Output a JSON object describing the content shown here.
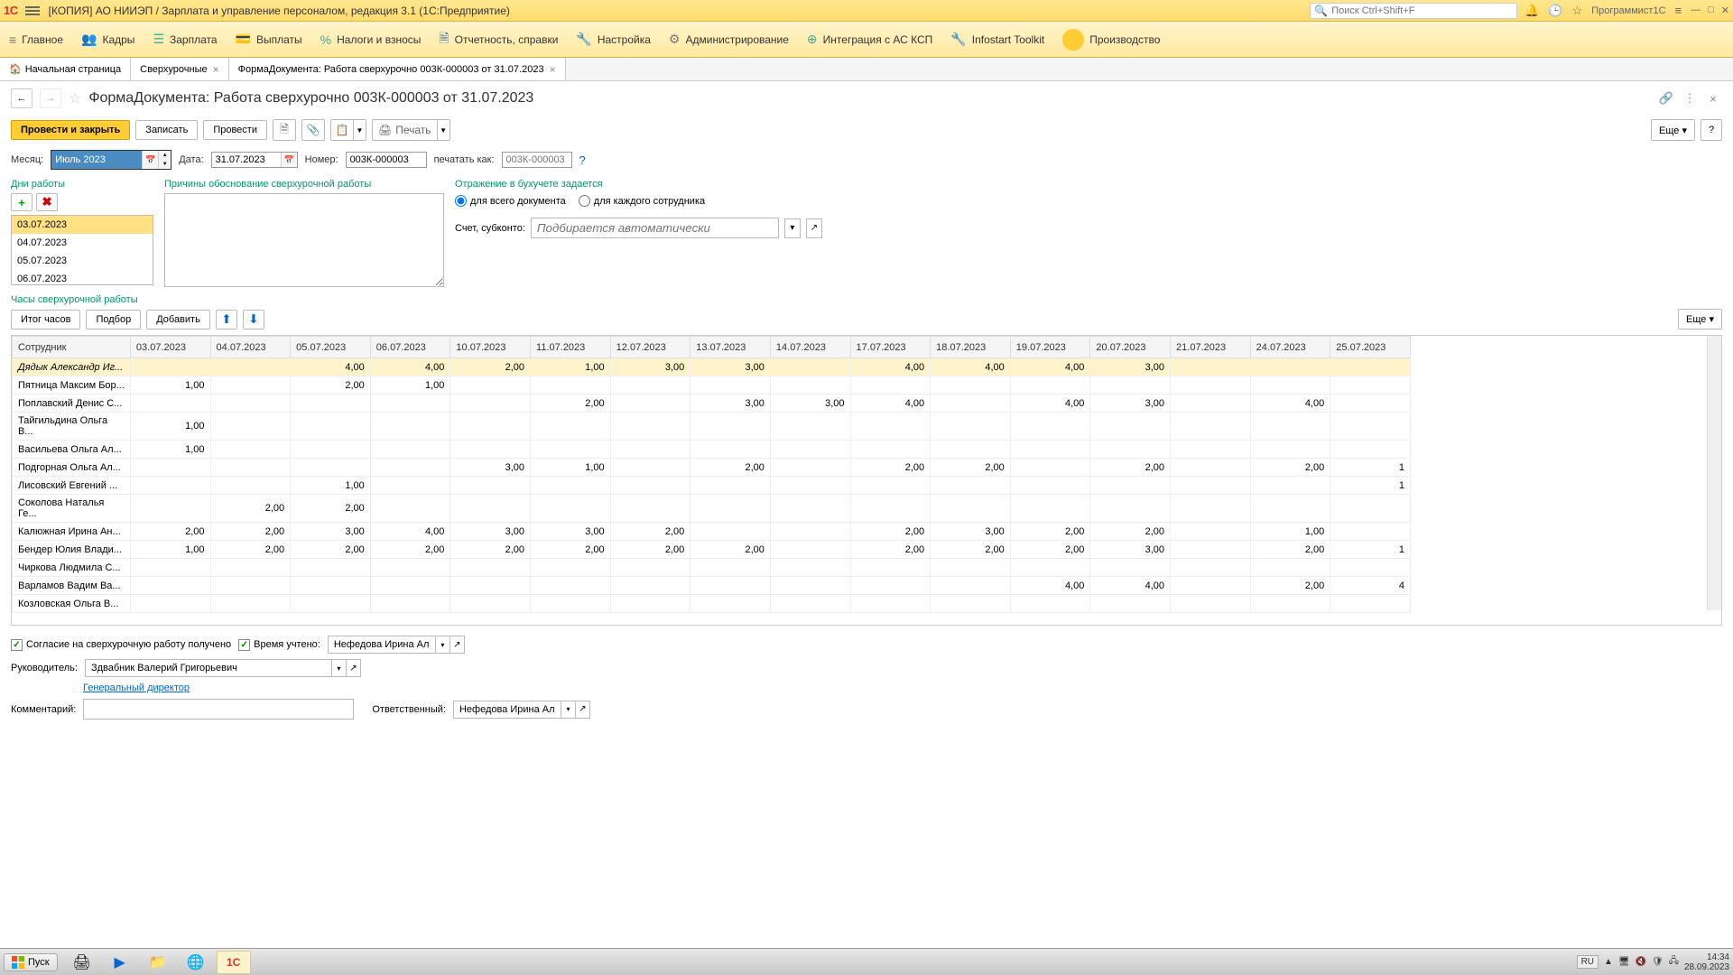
{
  "titlebar": {
    "logo": "1С",
    "text": "[КОПИЯ] АО НИИЭП / Зарплата и управление персоналом, редакция 3.1  (1С:Предприятие)",
    "search_placeholder": "Поиск Ctrl+Shift+F",
    "user": "Программист1С"
  },
  "mainmenu": {
    "items": [
      {
        "icon": "≡",
        "label": "Главное"
      },
      {
        "icon": "👥",
        "label": "Кадры"
      },
      {
        "icon": "📋",
        "label": "Зарплата"
      },
      {
        "icon": "💳",
        "label": "Выплаты"
      },
      {
        "icon": "%",
        "label": "Налоги и взносы"
      },
      {
        "icon": "📄",
        "label": "Отчетность, справки"
      },
      {
        "icon": "🔧",
        "label": "Настройка"
      },
      {
        "icon": "⚙",
        "label": "Администрирование"
      },
      {
        "icon": "⊕",
        "label": "Интеграция с АС КСП"
      },
      {
        "icon": "🔧",
        "label": "Infostart Toolkit"
      },
      {
        "icon": "",
        "label": "Производство"
      }
    ]
  },
  "tabs": {
    "home": "Начальная страница",
    "items": [
      {
        "label": "Сверхурочные"
      },
      {
        "label": "ФормаДокумента: Работа сверхурочно 003К-000003 от 31.07.2023"
      }
    ]
  },
  "form": {
    "title": "ФормаДокумента: Работа сверхурочно 003К-000003 от 31.07.2023",
    "btn_primary": "Провести и закрыть",
    "btn_save": "Записать",
    "btn_post": "Провести",
    "btn_print": "Печать",
    "btn_more": "Еще",
    "month_label": "Месяц:",
    "month_value": "Июль 2023",
    "date_label": "Дата:",
    "date_value": "31.07.2023",
    "number_label": "Номер:",
    "number_value": "003К-000003",
    "print_as_label": "печатать как:",
    "print_as_placeholder": "003К-000003",
    "days_label": "Дни работы",
    "reasons_label": "Причины обоснование сверхурочной работы",
    "accounting_label": "Отражение в бухучете задается",
    "radio_all": "для всего документа",
    "radio_each": "для каждого сотрудника",
    "account_label": "Счет, субконто:",
    "account_placeholder": "Подбирается автоматически",
    "days": [
      "03.07.2023",
      "04.07.2023",
      "05.07.2023",
      "06.07.2023"
    ],
    "hours_label": "Часы сверхурочной работы",
    "btn_totals": "Итог часов",
    "btn_select": "Подбор",
    "btn_add": "Добавить"
  },
  "grid": {
    "col_emp": "Сотрудник",
    "cols": [
      "03.07.2023",
      "04.07.2023",
      "05.07.2023",
      "06.07.2023",
      "10.07.2023",
      "11.07.2023",
      "12.07.2023",
      "13.07.2023",
      "14.07.2023",
      "17.07.2023",
      "18.07.2023",
      "19.07.2023",
      "20.07.2023",
      "21.07.2023",
      "24.07.2023",
      "25.07.2023"
    ],
    "rows": [
      {
        "emp": "Дядык Александр Иг...",
        "v": [
          "",
          "",
          "4,00",
          "4,00",
          "2,00",
          "1,00",
          "3,00",
          "3,00",
          "",
          "4,00",
          "4,00",
          "4,00",
          "3,00",
          "",
          "",
          ""
        ]
      },
      {
        "emp": "Пятница Максим Бор...",
        "v": [
          "1,00",
          "",
          "2,00",
          "1,00",
          "",
          "",
          "",
          "",
          "",
          "",
          "",
          "",
          "",
          "",
          "",
          ""
        ]
      },
      {
        "emp": "Поплавский Денис С...",
        "v": [
          "",
          "",
          "",
          "",
          "",
          "2,00",
          "",
          "3,00",
          "3,00",
          "4,00",
          "",
          "4,00",
          "3,00",
          "",
          "4,00",
          ""
        ]
      },
      {
        "emp": "Тайгильдина Ольга В...",
        "v": [
          "1,00",
          "",
          "",
          "",
          "",
          "",
          "",
          "",
          "",
          "",
          "",
          "",
          "",
          "",
          "",
          ""
        ]
      },
      {
        "emp": "Васильева Ольга Ал...",
        "v": [
          "1,00",
          "",
          "",
          "",
          "",
          "",
          "",
          "",
          "",
          "",
          "",
          "",
          "",
          "",
          "",
          ""
        ]
      },
      {
        "emp": "Подгорная Ольга Ал...",
        "v": [
          "",
          "",
          "",
          "",
          "3,00",
          "1,00",
          "",
          "2,00",
          "",
          "2,00",
          "2,00",
          "",
          "2,00",
          "",
          "2,00",
          "1"
        ]
      },
      {
        "emp": "Лисовский Евгений ...",
        "v": [
          "",
          "",
          "1,00",
          "",
          "",
          "",
          "",
          "",
          "",
          "",
          "",
          "",
          "",
          "",
          "",
          "1"
        ]
      },
      {
        "emp": "Соколова Наталья Ге...",
        "v": [
          "",
          "2,00",
          "2,00",
          "",
          "",
          "",
          "",
          "",
          "",
          "",
          "",
          "",
          "",
          "",
          "",
          ""
        ]
      },
      {
        "emp": "Калюжная Ирина Ан...",
        "v": [
          "2,00",
          "2,00",
          "3,00",
          "4,00",
          "3,00",
          "3,00",
          "2,00",
          "",
          "",
          "2,00",
          "3,00",
          "2,00",
          "2,00",
          "",
          "1,00",
          ""
        ]
      },
      {
        "emp": "Бендер Юлия Влади...",
        "v": [
          "1,00",
          "2,00",
          "2,00",
          "2,00",
          "2,00",
          "2,00",
          "2,00",
          "2,00",
          "",
          "2,00",
          "2,00",
          "2,00",
          "3,00",
          "",
          "2,00",
          "1"
        ]
      },
      {
        "emp": "Чиркова Людмила С...",
        "v": [
          "",
          "",
          "",
          "",
          "",
          "",
          "",
          "",
          "",
          "",
          "",
          "",
          "",
          "",
          "",
          ""
        ]
      },
      {
        "emp": "Варламов Вадим Ва...",
        "v": [
          "",
          "",
          "",
          "",
          "",
          "",
          "",
          "",
          "",
          "",
          "",
          "4,00",
          "4,00",
          "",
          "2,00",
          "4"
        ]
      },
      {
        "emp": "Козловская Ольга В...",
        "v": [
          "",
          "",
          "",
          "",
          "",
          "",
          "",
          "",
          "",
          "",
          "",
          "",
          "",
          "",
          "",
          ""
        ]
      }
    ]
  },
  "bottom": {
    "consent_label": "Согласие на сверхурочную работу получено",
    "time_label": "Время учтено:",
    "time_value": "Нефедова Ирина Алексан",
    "leader_label": "Руководитель:",
    "leader_value": "Здвабник Валерий Григорьевич",
    "position_link": "Генеральный директор",
    "comment_label": "Комментарий:",
    "responsible_label": "Ответственный:",
    "responsible_value": "Нефедова Ирина Алексан"
  },
  "taskbar": {
    "start": "Пуск",
    "lang": "RU",
    "time": "14:34",
    "date": "28.09.2023"
  }
}
